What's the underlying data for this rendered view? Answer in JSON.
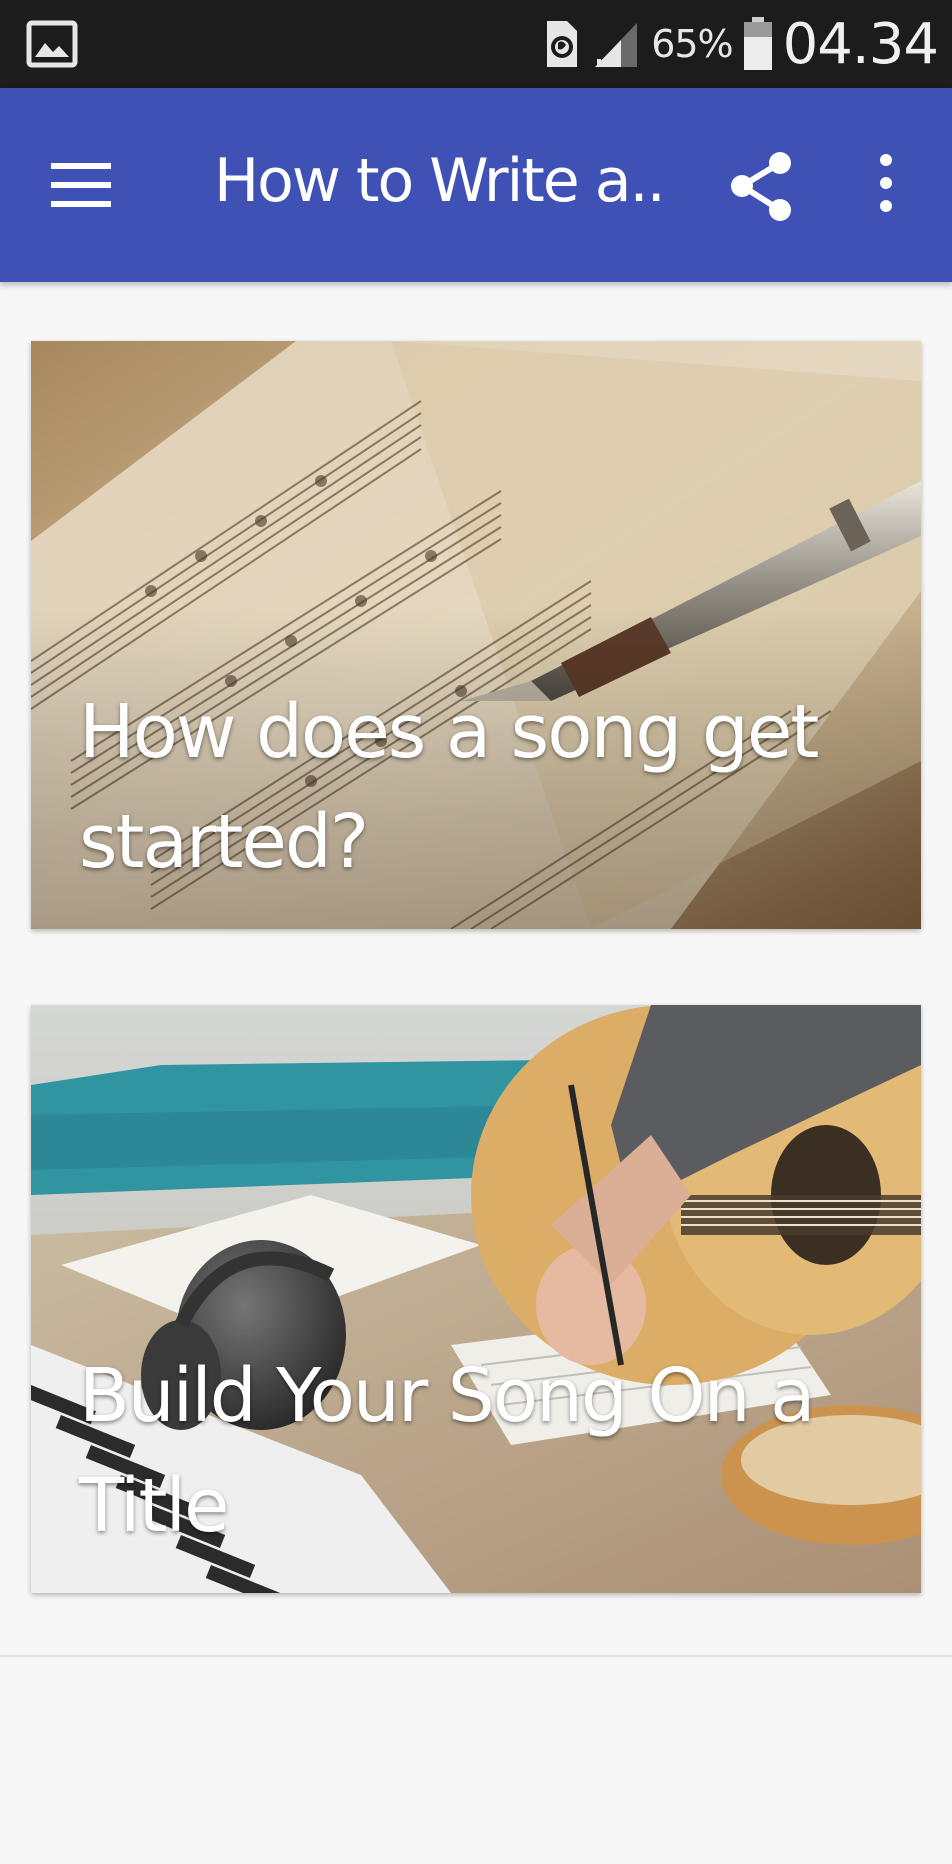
{
  "status_bar": {
    "battery_percent": "65%",
    "time": "04.34",
    "icons": [
      "gallery-icon",
      "data-saver-icon",
      "signal-icon",
      "battery-icon"
    ]
  },
  "app_bar": {
    "title": "How to Write a...",
    "background_color": "#3f51b5",
    "icons": [
      "menu-icon",
      "share-icon",
      "more-vert-icon"
    ]
  },
  "cards": [
    {
      "title": "How does a song get started?"
    },
    {
      "title": "Build Your Song On a Title"
    }
  ]
}
